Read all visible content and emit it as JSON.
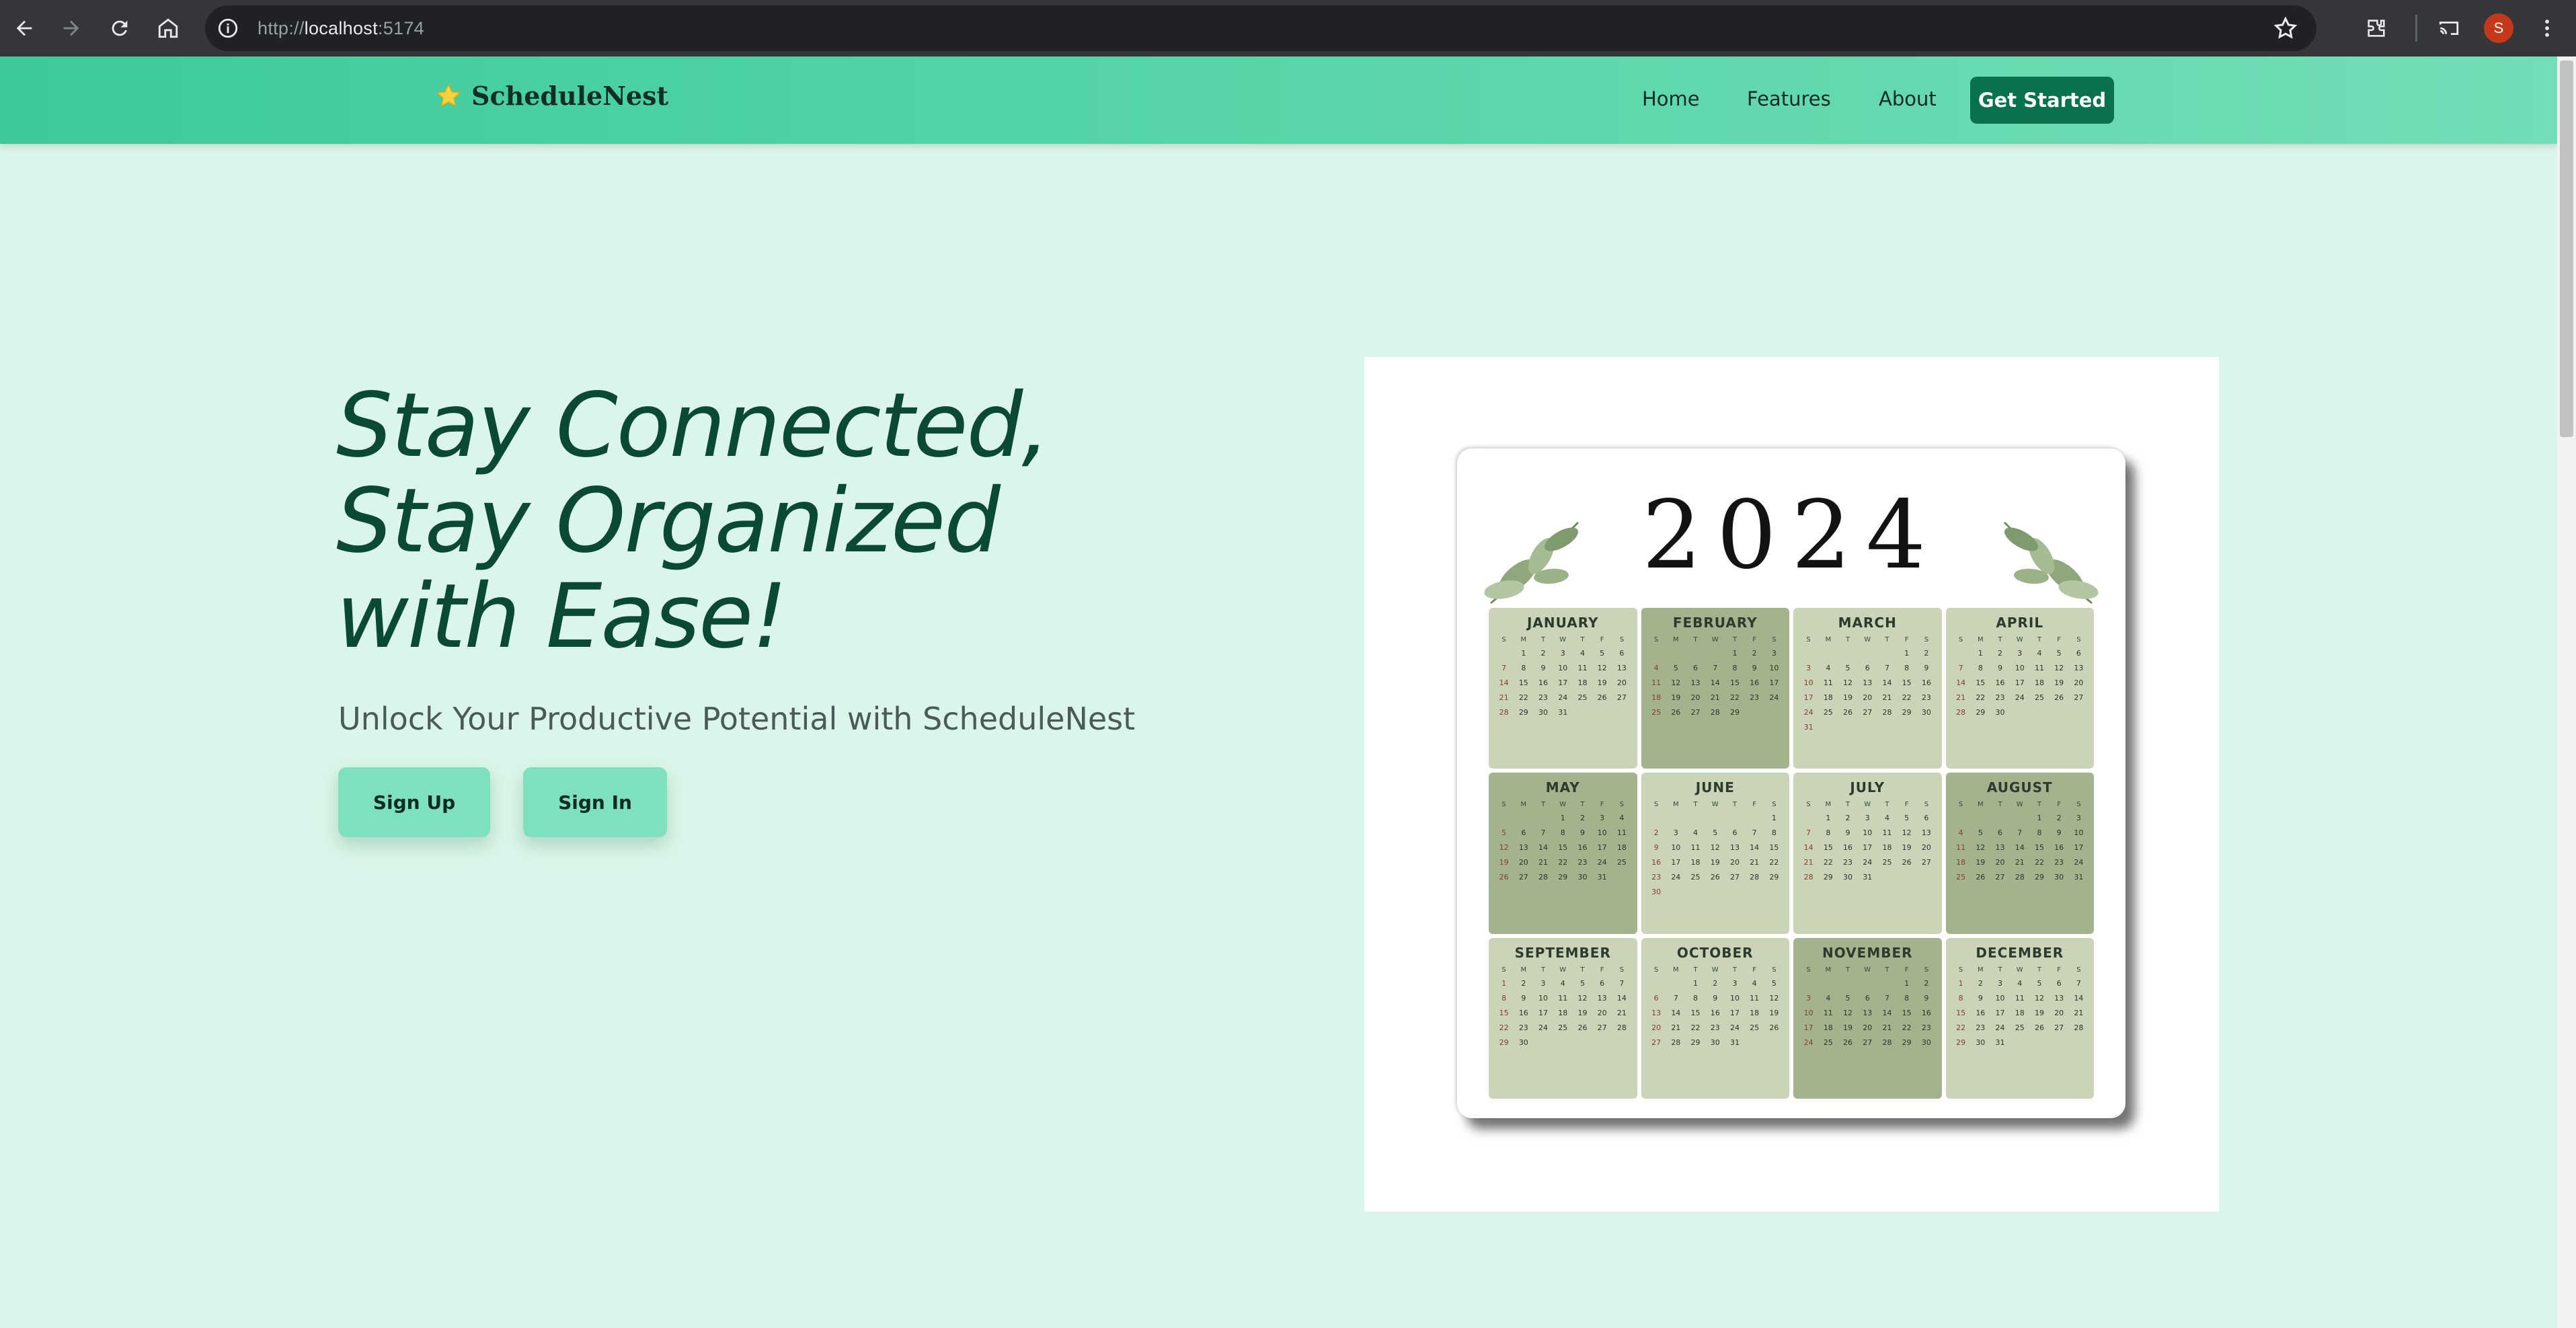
{
  "browser": {
    "url_scheme": "http://",
    "url_host": "localhost",
    "url_port": ":5174",
    "profile_initial": "S"
  },
  "navbar": {
    "brand": "ScheduleNest",
    "links": [
      "Home",
      "Features",
      "About"
    ],
    "cta": "Get Started"
  },
  "hero": {
    "headline_lines": [
      "Stay Connected,",
      "Stay Organized",
      "with Ease!"
    ],
    "subline": "Unlock Your Productive Potential with ScheduleNest",
    "signup_label": "Sign Up",
    "signin_label": "Sign In"
  },
  "calendar_image": {
    "year": "2024",
    "days_of_week": [
      "S",
      "M",
      "T",
      "W",
      "T",
      "F",
      "S"
    ],
    "months": [
      {
        "name": "JANUARY",
        "shade": "light",
        "offset": 1,
        "length": 31
      },
      {
        "name": "FEBRUARY",
        "shade": "dark",
        "offset": 4,
        "length": 29
      },
      {
        "name": "MARCH",
        "shade": "light",
        "offset": 5,
        "length": 31
      },
      {
        "name": "APRIL",
        "shade": "light",
        "offset": 1,
        "length": 30
      },
      {
        "name": "MAY",
        "shade": "dark",
        "offset": 3,
        "length": 31
      },
      {
        "name": "JUNE",
        "shade": "light",
        "offset": 6,
        "length": 30
      },
      {
        "name": "JULY",
        "shade": "light",
        "offset": 1,
        "length": 31
      },
      {
        "name": "AUGUST",
        "shade": "dark",
        "offset": 4,
        "length": 31
      },
      {
        "name": "SEPTEMBER",
        "shade": "light",
        "offset": 0,
        "length": 30
      },
      {
        "name": "OCTOBER",
        "shade": "light",
        "offset": 2,
        "length": 31
      },
      {
        "name": "NOVEMBER",
        "shade": "dark",
        "offset": 5,
        "length": 30
      },
      {
        "name": "DECEMBER",
        "shade": "light",
        "offset": 0,
        "length": 31
      }
    ]
  },
  "colors": {
    "page_bg": "#dcf5ea",
    "cta_bg": "#0a7150",
    "headline": "#0a4a35",
    "button_bg": "#7fe0bd"
  }
}
